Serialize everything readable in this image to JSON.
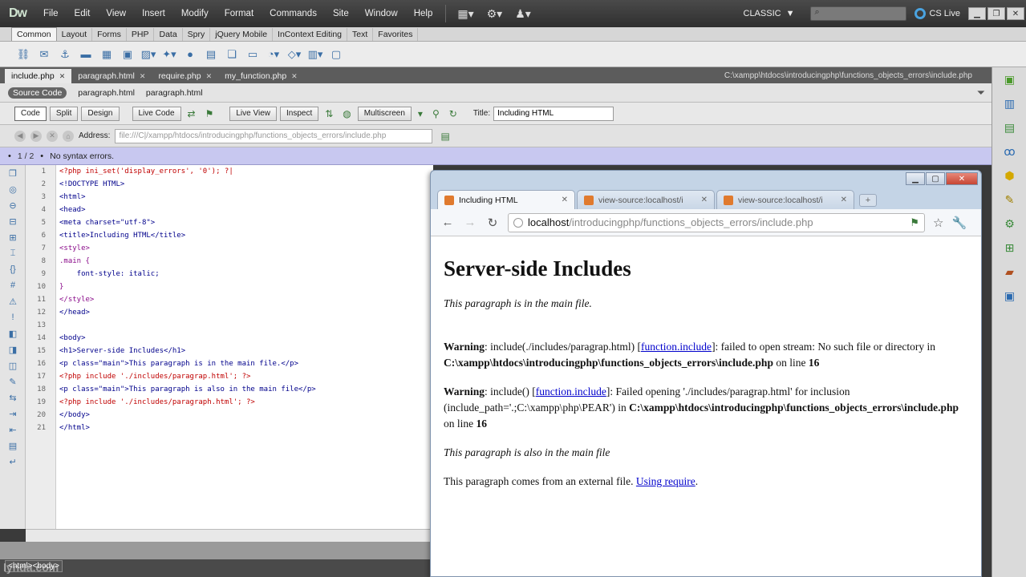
{
  "app": {
    "logo": "Dw",
    "menu": [
      "File",
      "Edit",
      "View",
      "Insert",
      "Modify",
      "Format",
      "Commands",
      "Site",
      "Window",
      "Help"
    ],
    "workspace": "CLASSIC",
    "workspace_arrow": "▼",
    "cslive": "CS Live"
  },
  "insert_panel": {
    "tabs": [
      "Common",
      "Layout",
      "Forms",
      "PHP",
      "Data",
      "Spry",
      "jQuery Mobile",
      "InContext Editing",
      "Text",
      "Favorites"
    ]
  },
  "doc_tabs": {
    "tabs": [
      {
        "label": "include.php",
        "active": true
      },
      {
        "label": "paragraph.html",
        "active": false
      },
      {
        "label": "require.php",
        "active": false
      },
      {
        "label": "my_function.php",
        "active": false
      }
    ],
    "path": "C:\\xampp\\htdocs\\introducingphp\\functions_objects_errors\\include.php"
  },
  "related_files": [
    "Source Code",
    "paragraph.html",
    "paragraph.html"
  ],
  "doc_toolbar": {
    "code": "Code",
    "split": "Split",
    "design": "Design",
    "live_code": "Live Code",
    "live_view": "Live View",
    "inspect": "Inspect",
    "multiscreen": "Multiscreen",
    "title_label": "Title:",
    "title_value": "Including HTML"
  },
  "address_bar": {
    "label": "Address:",
    "value": "file:///C|/xampp/htdocs/introducingphp/functions_objects_errors/include.php"
  },
  "syntax": {
    "count": "1 / 2",
    "message": "No syntax errors."
  },
  "code": {
    "lines": [
      {
        "n": "1",
        "text": "<?php ini_set('display_errors', '0'); ?|",
        "kind": "php"
      },
      {
        "n": "2",
        "text": "<!DOCTYPE HTML>",
        "kind": "html"
      },
      {
        "n": "3",
        "text": "<html>",
        "kind": "html"
      },
      {
        "n": "4",
        "text": "<head>",
        "kind": "html"
      },
      {
        "n": "5",
        "text": "<meta charset=\"utf-8\">",
        "kind": "html"
      },
      {
        "n": "6",
        "text": "<title>Including HTML</title>",
        "kind": "html"
      },
      {
        "n": "7",
        "text": "<style>",
        "kind": "css"
      },
      {
        "n": "8",
        "text": ".main {",
        "kind": "css"
      },
      {
        "n": "9",
        "text": "    font-style: italic;",
        "kind": "html"
      },
      {
        "n": "10",
        "text": "}",
        "kind": "css"
      },
      {
        "n": "11",
        "text": "</style>",
        "kind": "css"
      },
      {
        "n": "12",
        "text": "</head>",
        "kind": "html"
      },
      {
        "n": "13",
        "text": "",
        "kind": "html"
      },
      {
        "n": "14",
        "text": "<body>",
        "kind": "html"
      },
      {
        "n": "15",
        "text": "<h1>Server-side Includes</h1>",
        "kind": "html"
      },
      {
        "n": "16",
        "text": "<p class=\"main\">This paragraph is in the main file.</p>",
        "kind": "html"
      },
      {
        "n": "17",
        "text": "<?php include './includes/paragrap.html'; ?>",
        "kind": "php"
      },
      {
        "n": "18",
        "text": "<p class=\"main\">This paragraph is also in the main file</p>",
        "kind": "html"
      },
      {
        "n": "19",
        "text": "<?php include './includes/paragraph.html'; ?>",
        "kind": "php"
      },
      {
        "n": "20",
        "text": "</body>",
        "kind": "html"
      },
      {
        "n": "21",
        "text": "</html>",
        "kind": "html"
      }
    ]
  },
  "status": {
    "tag": "<html><body>",
    "watermark": "lynda.com"
  },
  "browser": {
    "tabs": [
      {
        "label": "Including HTML",
        "active": true
      },
      {
        "label": "view-source:localhost/i",
        "active": false
      },
      {
        "label": "view-source:localhost/i",
        "active": false
      }
    ],
    "url_host": "localhost",
    "url_path": "/introducingphp/functions_objects_errors/include.php",
    "page": {
      "h1": "Server-side Includes",
      "p1": "This paragraph is in the main file.",
      "warn1": {
        "label": "Warning",
        "text1": ": include(./includes/paragrap.html) [",
        "link": "function.include",
        "text2": "]: failed to open stream: No such file or directory in ",
        "path": "C:\\xampp\\htdocs\\introducingphp\\functions_objects_errors\\include.php",
        "text3": " on line ",
        "line": "16"
      },
      "warn2": {
        "label": "Warning",
        "text1": ": include() [",
        "link": "function.include",
        "text2": "]: Failed opening './includes/paragrap.html' for inclusion (include_path='.;C:\\xampp\\php\\PEAR') in ",
        "path": "C:\\xampp\\htdocs\\introducingphp\\functions_objects_errors\\include.php",
        "text3": " on line ",
        "line": "16"
      },
      "p2": "This paragraph is also in the main file",
      "p3": "This paragraph comes from an external file. ",
      "p3_link": "Using require",
      "p3_end": "."
    }
  }
}
